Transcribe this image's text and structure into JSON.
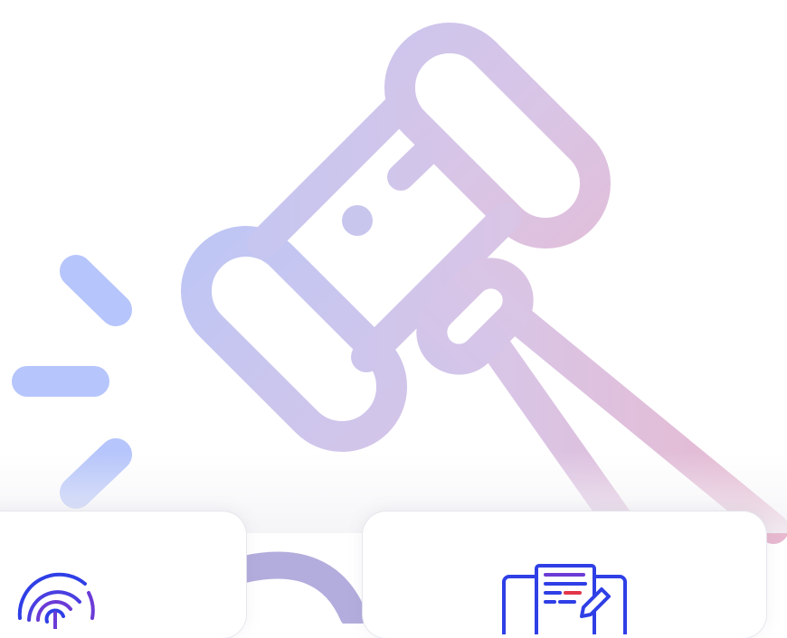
{
  "page": {
    "background": "#ffffff",
    "gradient_start": "#b9c3f5",
    "gradient_end": "#e6b6cf",
    "icon_accent_blue": "#2f3fe6",
    "icon_accent_purple": "#6b3bd6",
    "icon_accent_red": "#e2354a"
  },
  "hero": {
    "icon": "gavel-icon",
    "accent_marks": "impact-lines-icon"
  },
  "cards": [
    {
      "icon": "fingerprint-icon"
    },
    {
      "icon": "legal-document-pen-icon"
    }
  ]
}
